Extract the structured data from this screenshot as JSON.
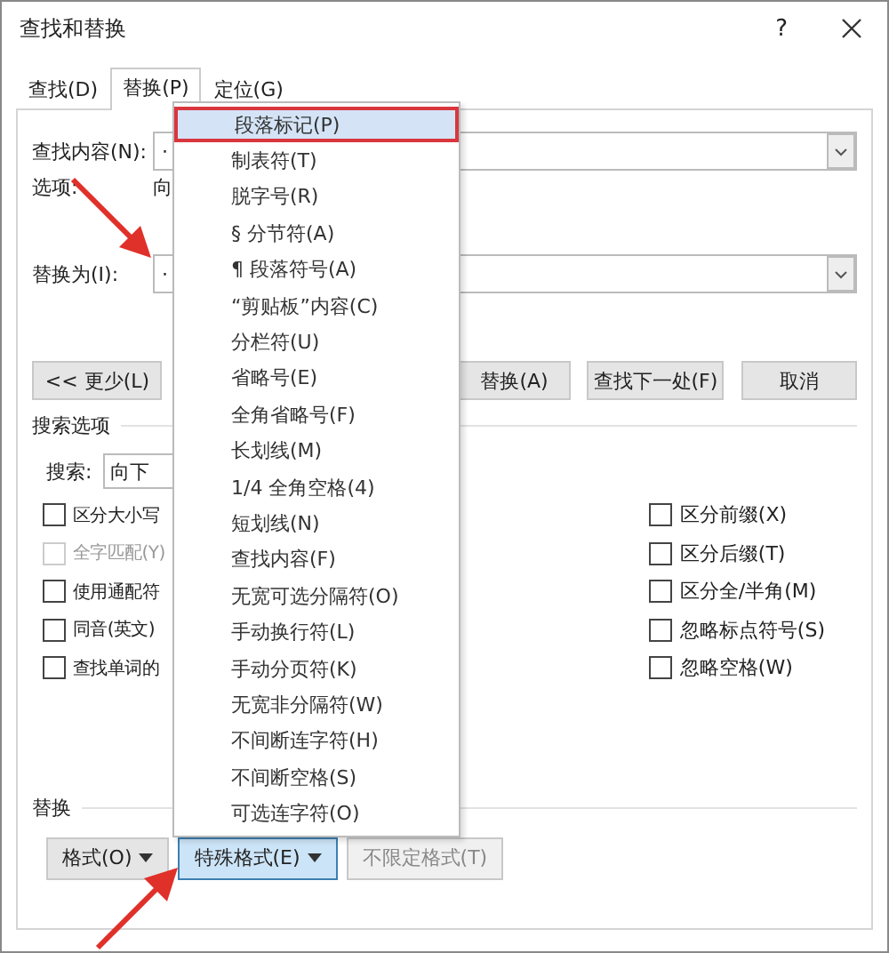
{
  "window": {
    "title": "查找和替换",
    "help": "?"
  },
  "tabs": [
    {
      "label": "查找(D)",
      "selected": false
    },
    {
      "label": "替换(P)",
      "selected": true
    },
    {
      "label": "定位(G)",
      "selected": false
    }
  ],
  "find": {
    "label": "查找内容(N):",
    "value": "·"
  },
  "options": {
    "label": "选项:",
    "value": "向"
  },
  "replace": {
    "label": "替换为(I):",
    "value": "·"
  },
  "buttons": [
    {
      "label": "<< 更少(L)"
    },
    {
      "label": "替换(A)"
    },
    {
      "label": "查找下一处(F)"
    },
    {
      "label": "取消"
    }
  ],
  "search_options": {
    "title": "搜索选项",
    "search_label": "搜索:",
    "search_value": "向下",
    "left_checkboxes": [
      {
        "label": "区分大小写",
        "checked": false,
        "disabled": false
      },
      {
        "label": "全字匹配(Y)",
        "checked": false,
        "disabled": true
      },
      {
        "label": "使用通配符",
        "checked": false,
        "disabled": false
      },
      {
        "label": "同音(英文)",
        "checked": false,
        "disabled": false
      },
      {
        "label": "查找单词的",
        "checked": false,
        "disabled": false
      }
    ],
    "right_checkboxes": [
      {
        "label": "区分前缀(X)",
        "checked": false,
        "disabled": false
      },
      {
        "label": "区分后缀(T)",
        "checked": false,
        "disabled": false
      },
      {
        "label": "区分全/半角(M)",
        "checked": false,
        "disabled": false
      },
      {
        "label": "忽略标点符号(S)",
        "checked": false,
        "disabled": false
      },
      {
        "label": "忽略空格(W)",
        "checked": false,
        "disabled": false
      }
    ]
  },
  "replace_section": {
    "title": "替换",
    "buttons": [
      {
        "label": "格式(O)",
        "selected": false,
        "disabled": false,
        "dropdown": true
      },
      {
        "label": "特殊格式(E)",
        "selected": true,
        "disabled": false,
        "dropdown": true
      },
      {
        "label": "不限定格式(T)",
        "selected": false,
        "disabled": true,
        "dropdown": false
      }
    ]
  },
  "special_menu": {
    "items": [
      {
        "label": "段落标记(P)",
        "selected": true
      },
      {
        "label": "制表符(T)",
        "selected": false
      },
      {
        "label": "脱字号(R)",
        "selected": false
      },
      {
        "label": "§ 分节符(A)",
        "selected": false
      },
      {
        "label": "¶ 段落符号(A)",
        "selected": false
      },
      {
        "label": "“剪贴板”内容(C)",
        "selected": false
      },
      {
        "label": "分栏符(U)",
        "selected": false
      },
      {
        "label": "省略号(E)",
        "selected": false
      },
      {
        "label": "全角省略号(F)",
        "selected": false
      },
      {
        "label": "长划线(M)",
        "selected": false
      },
      {
        "label": "1/4 全角空格(4)",
        "selected": false
      },
      {
        "label": "短划线(N)",
        "selected": false
      },
      {
        "label": "查找内容(F)",
        "selected": false
      },
      {
        "label": "无宽可选分隔符(O)",
        "selected": false
      },
      {
        "label": "手动换行符(L)",
        "selected": false
      },
      {
        "label": "手动分页符(K)",
        "selected": false
      },
      {
        "label": "无宽非分隔符(W)",
        "selected": false
      },
      {
        "label": "不间断连字符(H)",
        "selected": false
      },
      {
        "label": "不间断空格(S)",
        "selected": false
      },
      {
        "label": "可选连字符(O)",
        "selected": false
      }
    ]
  }
}
